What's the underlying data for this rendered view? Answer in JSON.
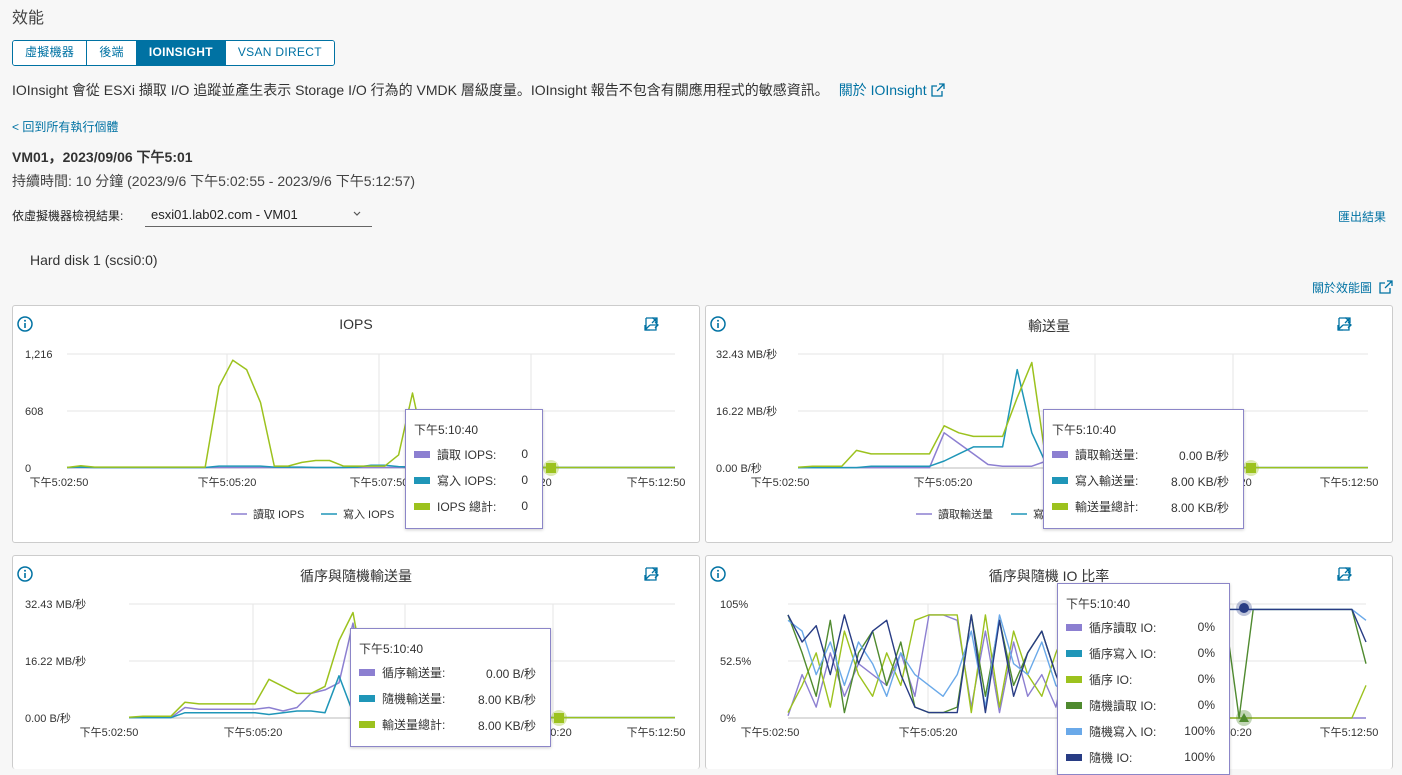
{
  "page": {
    "title": "效能",
    "tabs": [
      "虛擬機器",
      "後端",
      "IOINSIGHT",
      "VSAN DIRECT"
    ],
    "active_tab": 2,
    "description": "IOInsight 會從 ESXi 擷取 I/O 追蹤並產生表示 Storage I/O 行為的 VMDK 層級度量。IOInsight 報告不包含有關應用程式的敏感資訊。",
    "about_link": "關於 IOInsight",
    "back_link": "< 回到所有執行個體",
    "run_title": "VM01，2023/09/06 下午5:01",
    "duration": "持續時間: 10 分鐘 (2023/9/6 下午5:02:55 - 2023/9/6 下午5:12:57)",
    "vm_filter_label": "依虛擬機器檢視結果:",
    "vm_filter_value": "esxi01.lab02.com - VM01",
    "export_label": "匯出結果",
    "disk_label": "Hard disk 1 (scsi0:0)",
    "about_chart_link": "關於效能圖"
  },
  "colors": {
    "accent": "#0072a3",
    "purple": "#8c7fd1",
    "teal": "#1f96b8",
    "green": "#9cc21e",
    "dark_green": "#4f8a2f",
    "light_blue": "#6aa9e9",
    "navy": "#283c84"
  },
  "charts": {
    "iops": {
      "title": "IOPS",
      "y_ticks": [
        "1,216",
        "608",
        "0"
      ],
      "x_ticks": [
        "下午5:02:50",
        "下午5:05:20",
        "下午5:07:50",
        "0:20",
        "下午5:12:50"
      ],
      "legend": [
        "讀取 IOPS",
        "寫入 IOPS"
      ],
      "tooltip": {
        "time": "下午5:10:40",
        "rows": [
          {
            "label": "讀取 IOPS:",
            "value": "0"
          },
          {
            "label": "寫入 IOPS:",
            "value": "0"
          },
          {
            "label": "IOPS 總計:",
            "value": "0"
          }
        ]
      }
    },
    "throughput": {
      "title": "輸送量",
      "y_ticks": [
        "32.43 MB/秒",
        "16.22 MB/秒",
        "0.00 B/秒"
      ],
      "x_ticks": [
        "下午5:02:50",
        "下午5:05:20",
        "0:20",
        "下午5:12:50"
      ],
      "legend": [
        "讀取輸送量",
        "寫"
      ],
      "tooltip": {
        "time": "下午5:10:40",
        "rows": [
          {
            "label": "讀取輸送量:",
            "value": "0.00 B/秒"
          },
          {
            "label": "寫入輸送量:",
            "value": "8.00 KB/秒"
          },
          {
            "label": "輸送量總計:",
            "value": "8.00 KB/秒"
          }
        ]
      }
    },
    "seq_random_tp": {
      "title": "循序與隨機輸送量",
      "y_ticks": [
        "32.43 MB/秒",
        "16.22 MB/秒",
        "0.00 B/秒"
      ],
      "x_ticks": [
        "下午5:02:50",
        "下午5:05:20",
        "0:20",
        "下午5:12:50"
      ],
      "tooltip": {
        "time": "下午5:10:40",
        "rows": [
          {
            "label": "循序輸送量:",
            "value": "0.00 B/秒"
          },
          {
            "label": "隨機輸送量:",
            "value": "8.00 KB/秒"
          },
          {
            "label": "輸送量總計:",
            "value": "8.00 KB/秒"
          }
        ]
      }
    },
    "seq_random_ratio": {
      "title": "循序與隨機 IO 比率",
      "y_ticks": [
        "105%",
        "52.5%",
        "0%"
      ],
      "x_ticks": [
        "下午5:02:50",
        "下午5:05:20",
        "0:20",
        "下午5:12:50"
      ],
      "tooltip": {
        "time": "下午5:10:40",
        "rows": [
          {
            "label": "循序讀取 IO:",
            "value": "0%"
          },
          {
            "label": "循序寫入 IO:",
            "value": "0%"
          },
          {
            "label": "循序 IO:",
            "value": "0%"
          },
          {
            "label": "隨機讀取 IO:",
            "value": "0%"
          },
          {
            "label": "隨機寫入 IO:",
            "value": "100%"
          },
          {
            "label": "隨機 IO:",
            "value": "100%"
          }
        ]
      }
    }
  },
  "chart_data": [
    {
      "type": "line",
      "title": "IOPS",
      "ylim": [
        0,
        1216
      ],
      "series": [
        {
          "name": "讀取 IOPS",
          "values": [
            5,
            5,
            5,
            5,
            5,
            5,
            5,
            5,
            5,
            5,
            5,
            5,
            5,
            5,
            5,
            5,
            5,
            5,
            5,
            5,
            5,
            5,
            5,
            5,
            5,
            5,
            5,
            5,
            5,
            5,
            5,
            5,
            5,
            5,
            5,
            5,
            5,
            5,
            5,
            5,
            5,
            5,
            5,
            5,
            5
          ]
        },
        {
          "name": "寫入 IOPS",
          "values": [
            5,
            10,
            5,
            5,
            5,
            5,
            5,
            5,
            5,
            5,
            5,
            20,
            20,
            20,
            20,
            10,
            10,
            10,
            5,
            5,
            5,
            10,
            30,
            30,
            15,
            10,
            5,
            10,
            5,
            5,
            5,
            5,
            5,
            5,
            5,
            5,
            5,
            5,
            5,
            5,
            5,
            5,
            5,
            5,
            5
          ]
        },
        {
          "name": "IOPS 總計",
          "values": [
            5,
            25,
            10,
            10,
            10,
            10,
            10,
            10,
            10,
            10,
            10,
            870,
            1150,
            1050,
            700,
            20,
            20,
            60,
            80,
            80,
            20,
            20,
            20,
            20,
            140,
            800,
            120,
            100,
            50,
            10,
            10,
            20,
            60,
            5,
            5,
            5,
            5,
            5,
            5,
            5,
            5,
            5,
            5,
            5,
            5
          ]
        }
      ]
    },
    {
      "type": "line",
      "title": "輸送量",
      "ylim": [
        0,
        32.43
      ],
      "series": [
        {
          "name": "讀取輸送量",
          "values": [
            0.1,
            0.1,
            0.1,
            0.1,
            0.1,
            0.1,
            0.1,
            0.1,
            0.1,
            0.1,
            10,
            7,
            4,
            1,
            0.5,
            0.5,
            0.5,
            2,
            0.5,
            0.2,
            0.1,
            0.1,
            0.1,
            0.1,
            0.1,
            0.1,
            0.1,
            0.1,
            0.1,
            0.1,
            0.1,
            0.1,
            0.1,
            0.1,
            0.1,
            0.1,
            0.1,
            0.1,
            0.1,
            0.1
          ]
        },
        {
          "name": "寫入輸送量",
          "values": [
            0.1,
            0.1,
            0.1,
            0.1,
            0.1,
            0.5,
            0.5,
            0.5,
            0.5,
            0.5,
            2,
            4,
            6,
            6,
            6,
            28,
            10,
            1,
            0.5,
            0.5,
            0.1,
            0.1,
            0.1,
            0.1,
            0.1,
            0.1,
            0.1,
            0.1,
            0.1,
            0.1,
            0.1,
            0.1,
            0.1,
            0.1,
            0.1,
            0.1,
            0.1,
            0.1,
            0.1,
            0.1
          ]
        },
        {
          "name": "輸送量總計",
          "values": [
            0.2,
            0.5,
            0.5,
            0.5,
            5,
            4,
            4,
            4,
            4,
            4,
            12,
            10,
            9,
            9,
            9,
            20,
            30,
            1,
            0.5,
            0.5,
            0.1,
            0.1,
            0.1,
            0.1,
            0.1,
            0.1,
            0.1,
            0.1,
            0.1,
            0.1,
            0.1,
            0.1,
            0.1,
            0.1,
            0.1,
            0.1,
            0.1,
            0.1,
            0.1,
            0.1
          ]
        }
      ]
    },
    {
      "type": "line",
      "title": "循序與隨機輸送量",
      "ylim": [
        0,
        32.43
      ],
      "series": [
        {
          "name": "循序輸送量",
          "values": [
            0.1,
            0.1,
            0.1,
            0.1,
            3,
            2.5,
            2.5,
            2.5,
            2.5,
            2.5,
            3,
            2,
            3,
            7,
            8,
            10,
            27,
            6,
            1,
            0.5,
            0.1,
            0.1,
            0.1,
            0.1,
            0.1,
            0.1,
            0.1,
            0.1,
            0.1,
            0.1,
            0.1,
            0.1,
            0.1,
            0.1,
            0.1,
            0.1,
            0.1,
            0.1,
            0.1,
            0.1
          ]
        },
        {
          "name": "隨機輸送量",
          "values": [
            0.1,
            0.1,
            0.1,
            0.1,
            1.5,
            1.5,
            1.5,
            1.5,
            1.5,
            1.5,
            1,
            1.5,
            2,
            2,
            1.5,
            12,
            1.5,
            1.5,
            0.5,
            0.5,
            0.1,
            0.1,
            0.1,
            0.1,
            0.1,
            0.1,
            0.1,
            0.1,
            0.1,
            0.1,
            0.1,
            0.1,
            0.1,
            0.1,
            0.1,
            0.1,
            0.1,
            0.1,
            0.1,
            0.1
          ]
        },
        {
          "name": "輸送量總計",
          "values": [
            0.2,
            0.5,
            0.5,
            0.5,
            4.5,
            4,
            4,
            4,
            4,
            4,
            11,
            9,
            7,
            7,
            9,
            22,
            30,
            8,
            1,
            0.5,
            0.1,
            0.1,
            0.1,
            0.1,
            0.1,
            0.1,
            0.1,
            0.1,
            0.1,
            0.1,
            0.1,
            0.1,
            0.1,
            0.1,
            0.1,
            0.1,
            0.1,
            0.1,
            0.1,
            0.1
          ]
        }
      ]
    },
    {
      "type": "line",
      "title": "循序與隨機 IO 比率",
      "ylim": [
        0,
        105
      ],
      "series": [
        {
          "name": "循序讀取 IO",
          "values": [
            2,
            40,
            10,
            60,
            20,
            50,
            40,
            30,
            60,
            20,
            95,
            95,
            90,
            10,
            80,
            5,
            70,
            20,
            40,
            10,
            70,
            30,
            90,
            10,
            50,
            0,
            0,
            0,
            0,
            0,
            0,
            0,
            0,
            0,
            0,
            0,
            0,
            0,
            0,
            0,
            0,
            0
          ]
        },
        {
          "name": "循序 IO",
          "values": [
            5,
            30,
            60,
            10,
            80,
            40,
            20,
            60,
            30,
            90,
            95,
            95,
            95,
            5,
            95,
            10,
            80,
            40,
            20,
            60,
            90,
            30,
            80,
            20,
            60,
            0,
            0,
            0,
            0,
            0,
            0,
            0,
            0,
            0,
            0,
            0,
            0,
            0,
            0,
            0,
            0,
            30
          ]
        },
        {
          "name": "隨機讀取 IO",
          "values": [
            95,
            60,
            20,
            90,
            5,
            60,
            80,
            30,
            70,
            10,
            5,
            5,
            10,
            95,
            20,
            90,
            30,
            60,
            80,
            40,
            10,
            70,
            20,
            90,
            40,
            100,
            100,
            100,
            100,
            0,
            95,
            95,
            0,
            100,
            100,
            100,
            100,
            100,
            100,
            100,
            100,
            50
          ]
        },
        {
          "name": "隨機寫入 IO",
          "values": [
            90,
            80,
            40,
            70,
            30,
            70,
            50,
            20,
            60,
            40,
            30,
            20,
            40,
            80,
            10,
            95,
            50,
            40,
            70,
            30,
            20,
            80,
            40,
            70,
            50,
            100,
            100,
            100,
            100,
            100,
            30,
            100,
            100,
            100,
            100,
            100,
            100,
            100,
            100,
            100,
            100,
            90
          ]
        },
        {
          "name": "隨機 IO",
          "values": [
            95,
            70,
            85,
            40,
            95,
            50,
            80,
            90,
            40,
            10,
            5,
            5,
            5,
            95,
            5,
            90,
            20,
            60,
            80,
            40,
            10,
            70,
            20,
            80,
            40,
            100,
            100,
            100,
            100,
            100,
            100,
            100,
            100,
            100,
            100,
            100,
            100,
            100,
            100,
            100,
            100,
            70
          ]
        }
      ]
    }
  ]
}
